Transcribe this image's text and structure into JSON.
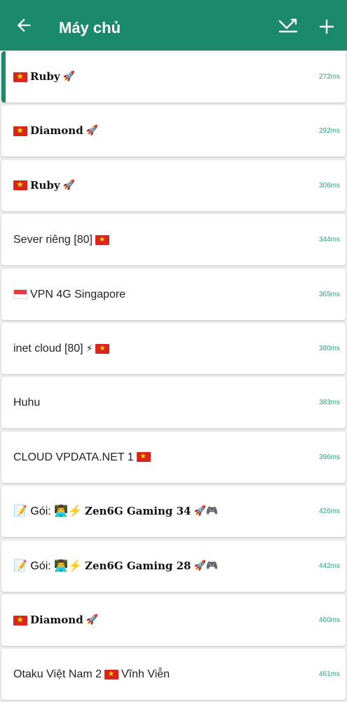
{
  "appbar": {
    "title": "Máy chủ",
    "back_icon": "arrow-left-icon",
    "sort_icon": "sort-ping-icon",
    "add_icon": "plus-icon",
    "background": "#1a8a6a"
  },
  "servers": [
    {
      "name": "Ruby",
      "prefix": "",
      "suffix": "🚀",
      "flag": "vn",
      "flag_pos": "before",
      "ping": "272ms",
      "serif": true,
      "active": true
    },
    {
      "name": "Diamond",
      "prefix": "",
      "suffix": "🚀",
      "flag": "vn",
      "flag_pos": "before",
      "ping": "292ms",
      "serif": true,
      "active": false
    },
    {
      "name": "Ruby",
      "prefix": "",
      "suffix": "🚀",
      "flag": "vn",
      "flag_pos": "before",
      "ping": "306ms",
      "serif": true,
      "active": false
    },
    {
      "name": "Sever riêng [80]",
      "prefix": "",
      "suffix": "",
      "flag": "vn",
      "flag_pos": "after",
      "ping": "344ms",
      "serif": false,
      "active": false
    },
    {
      "name": "VPN 4G Singapore",
      "prefix": "",
      "suffix": "",
      "flag": "sg",
      "flag_pos": "before",
      "ping": "365ms",
      "serif": false,
      "active": false
    },
    {
      "name": "inet cloud [80]",
      "prefix": "",
      "suffix": "⚡",
      "flag": "vn",
      "flag_pos": "after",
      "ping": "380ms",
      "serif": false,
      "active": false
    },
    {
      "name": "Huhu",
      "prefix": "",
      "suffix": "",
      "flag": "",
      "flag_pos": "",
      "ping": "383ms",
      "serif": false,
      "active": false
    },
    {
      "name": "CLOUD VPDATA.NET 1",
      "prefix": "",
      "suffix": "",
      "flag": "vn",
      "flag_pos": "after",
      "ping": "396ms",
      "serif": false,
      "active": false
    },
    {
      "name": "Zen6G Gaming 34",
      "prefix": "📝 Gói: 👨‍💻⚡",
      "suffix": "🚀🎮",
      "flag": "",
      "flag_pos": "",
      "ping": "426ms",
      "serif": true,
      "active": false
    },
    {
      "name": "Zen6G Gaming 28",
      "prefix": "📝 Gói: 👨‍💻⚡",
      "suffix": "🚀🎮",
      "flag": "",
      "flag_pos": "",
      "ping": "442ms",
      "serif": true,
      "active": false
    },
    {
      "name": "Diamond",
      "prefix": "",
      "suffix": "🚀",
      "flag": "vn",
      "flag_pos": "before",
      "ping": "460ms",
      "serif": true,
      "active": false
    },
    {
      "name": "Otaku Việt Nam 2",
      "prefix": "",
      "suffix": "Vĩnh Viễn",
      "flag": "vn",
      "flag_pos": "middle",
      "ping": "461ms",
      "serif": false,
      "active": false
    }
  ]
}
